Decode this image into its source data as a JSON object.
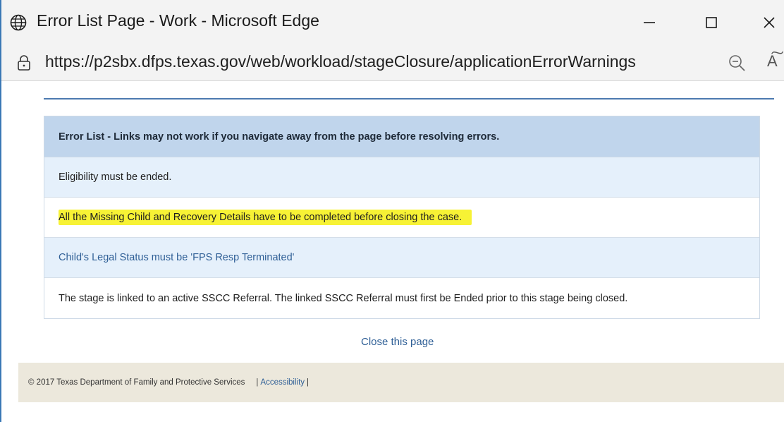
{
  "window": {
    "title": "Error List Page - Work - Microsoft Edge",
    "minimize_glyph": "—",
    "maximize_glyph": "☐",
    "close_glyph": "✕"
  },
  "address_bar": {
    "url": "https://p2sbx.dfps.texas.gov/web/workload/stageClosure/applicationErrorWarnings",
    "read_aloud_glyph": "A͠"
  },
  "icons": {
    "title": "globe-icon",
    "address": "lock-icon",
    "zoom": "zoom-out-icon",
    "read_aloud": "read-aloud-icon"
  },
  "error_list": {
    "header": "Error List - Links may not work if you navigate away from the page before resolving errors.",
    "rows": [
      "Eligibility must be ended.",
      "All the Missing Child and Recovery Details have to be completed before closing the case.",
      "Child's Legal Status must be 'FPS Resp Terminated'",
      "The stage is linked to an active SSCC Referral. The linked SSCC Referral must first be Ended prior to this stage being closed."
    ]
  },
  "close_link": "Close this page",
  "footer": {
    "copyright": "© 2017 Texas Department of Family and Protective Services",
    "separator_left": "|",
    "accessibility": "Accessibility",
    "separator_right": "|"
  },
  "colors": {
    "window_border": "#3a78b5",
    "header_bg": "#c0d5ec",
    "alt_row_bg": "#e5f0fb",
    "link": "#2f5f96",
    "highlight": "#f7f235",
    "footer_bg": "#ece8dc"
  }
}
